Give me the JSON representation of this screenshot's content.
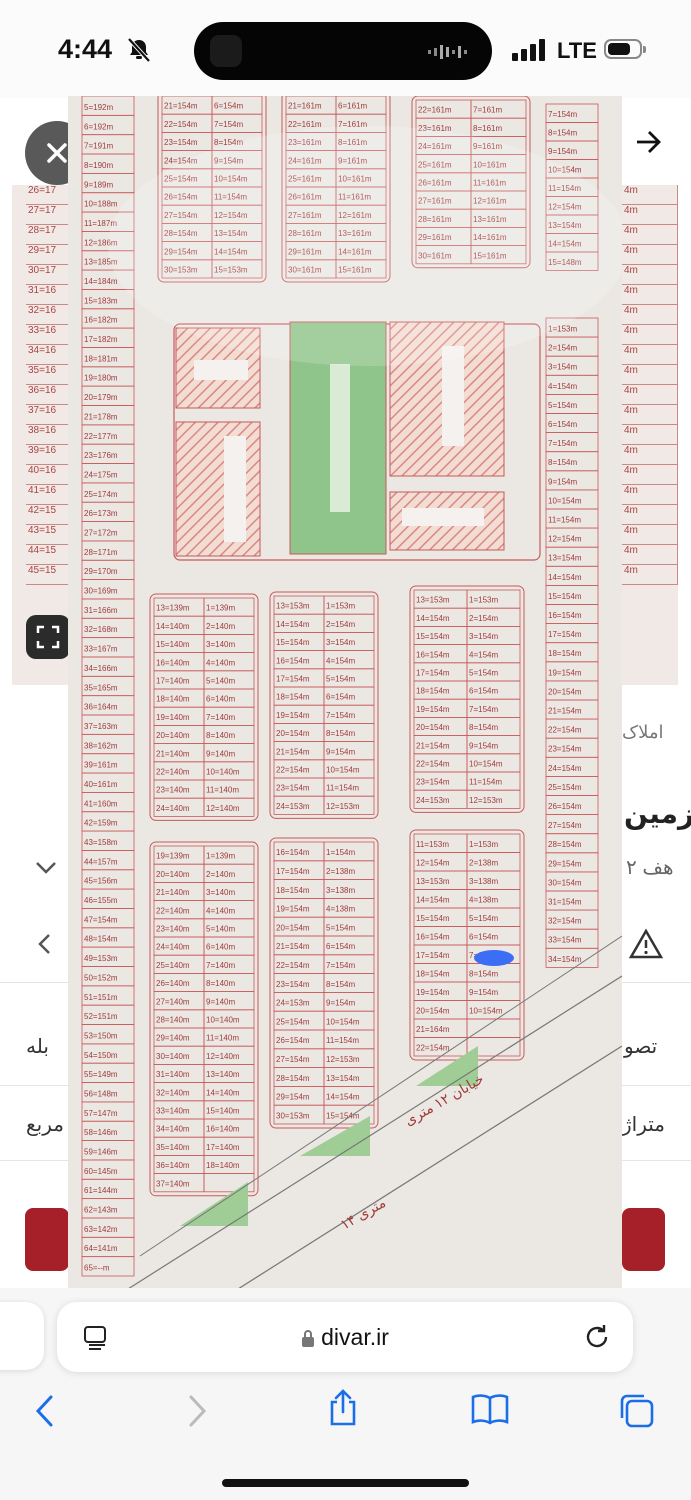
{
  "status_bar": {
    "time": "4:44",
    "network": "LTE"
  },
  "background_page": {
    "category": "املاک",
    "title_fragment": "زمین",
    "subtitle_fragment": "۲ هف",
    "row1_label": "تصو",
    "row1_value": "بله",
    "row2_label": "متراژ",
    "row2_value": "مربع"
  },
  "browser": {
    "url": "divar.ir"
  },
  "map": {
    "left_column_labels": [
      "5=192m",
      "6=192m",
      "7=191m",
      "8=190m",
      "9=189m",
      "10=188m",
      "11=187m",
      "12=186m",
      "13=185m",
      "14=184m",
      "15=183m",
      "16=182m",
      "17=182m",
      "18=181m",
      "19=180m",
      "20=179m",
      "21=178m",
      "22=177m",
      "23=176m",
      "24=175m",
      "25=174m",
      "26=173m",
      "27=172m",
      "28=171m",
      "29=170m",
      "30=169m",
      "31=166m",
      "32=168m",
      "33=167m",
      "34=166m",
      "35=165m",
      "36=164m",
      "37=163m",
      "38=162m",
      "39=161m",
      "40=161m",
      "41=160m",
      "42=159m",
      "43=158m",
      "44=157m",
      "45=156m",
      "46=155m",
      "47=154m",
      "48=154m",
      "49=153m",
      "50=152m",
      "51=151m",
      "52=151m",
      "53=150m",
      "54=150m",
      "55=149m",
      "56=148m",
      "57=147m",
      "58=146m",
      "59=146m",
      "60=145m",
      "61=144m",
      "62=143m",
      "63=142m",
      "64=141m",
      "65=--m"
    ],
    "top_block_a": [
      "21=154m",
      "6=154m",
      "22=154m",
      "7=154m",
      "23=154m",
      "8=154m",
      "24=154m",
      "9=154m",
      "25=154m",
      "10=154m",
      "26=154m",
      "11=154m",
      "27=154m",
      "12=154m",
      "28=154m",
      "13=154m",
      "29=154m",
      "14=154m",
      "30=153m",
      "15=153m"
    ],
    "top_block_b": [
      "21=161m",
      "6=161m",
      "22=161m",
      "7=161m",
      "23=161m",
      "8=161m",
      "24=161m",
      "9=161m",
      "25=161m",
      "10=161m",
      "26=161m",
      "11=161m",
      "27=161m",
      "12=161m",
      "28=161m",
      "13=161m",
      "29=161m",
      "14=161m",
      "30=161m",
      "15=161m"
    ],
    "top_block_c": [
      "22=161m",
      "7=161m",
      "23=161m",
      "8=161m",
      "24=161m",
      "9=161m",
      "25=161m",
      "10=161m",
      "26=161m",
      "11=161m",
      "27=161m",
      "12=161m",
      "28=161m",
      "13=161m",
      "29=161m",
      "14=161m",
      "30=161m",
      "15=161m"
    ],
    "top_right_column": [
      "7=154m",
      "8=154m",
      "9=154m",
      "10=154m",
      "11=154m",
      "12=154m",
      "13=154m",
      "14=154m",
      "15=148m"
    ],
    "right_column": [
      "1=153m",
      "2=154m",
      "3=154m",
      "4=154m",
      "5=154m",
      "6=154m",
      "7=154m",
      "8=154m",
      "9=154m",
      "10=154m",
      "11=154m",
      "12=154m",
      "13=154m",
      "14=154m",
      "15=154m",
      "16=154m",
      "17=154m",
      "18=154m",
      "19=154m",
      "20=154m",
      "21=154m",
      "22=154m",
      "23=154m",
      "24=154m",
      "25=154m",
      "26=154m",
      "27=154m",
      "28=154m",
      "29=154m",
      "30=154m",
      "31=154m",
      "32=154m",
      "33=154m",
      "34=154m"
    ],
    "block1": [
      "13=139m",
      "1=139m",
      "14=140m",
      "2=140m",
      "15=140m",
      "3=140m",
      "16=140m",
      "4=140m",
      "17=140m",
      "5=140m",
      "18=140m",
      "6=140m",
      "19=140m",
      "7=140m",
      "20=140m",
      "8=140m",
      "21=140m",
      "9=140m",
      "22=140m",
      "10=140m",
      "23=140m",
      "11=140m",
      "24=140m",
      "12=140m"
    ],
    "block2": [
      "13=153m",
      "1=153m",
      "14=154m",
      "2=154m",
      "15=154m",
      "3=154m",
      "16=154m",
      "4=154m",
      "17=154m",
      "5=154m",
      "18=154m",
      "6=154m",
      "19=154m",
      "7=154m",
      "20=154m",
      "8=154m",
      "21=154m",
      "9=154m",
      "22=154m",
      "10=154m",
      "23=154m",
      "11=154m",
      "24=153m",
      "12=153m"
    ],
    "block3": [
      "13=153m",
      "1=153m",
      "14=154m",
      "2=154m",
      "15=154m",
      "3=154m",
      "16=154m",
      "4=154m",
      "17=154m",
      "5=154m",
      "18=154m",
      "6=154m",
      "19=154m",
      "7=154m",
      "20=154m",
      "8=154m",
      "21=154m",
      "9=154m",
      "22=154m",
      "10=154m",
      "23=154m",
      "11=154m",
      "24=153m",
      "12=153m"
    ],
    "block4": [
      "19=139m",
      "1=139m",
      "20=140m",
      "2=140m",
      "21=140m",
      "3=140m",
      "22=140m",
      "4=140m",
      "23=140m",
      "5=140m",
      "24=140m",
      "6=140m",
      "25=140m",
      "7=140m",
      "26=140m",
      "8=140m",
      "27=140m",
      "9=140m",
      "28=140m",
      "10=140m",
      "29=140m",
      "11=140m",
      "30=140m",
      "12=140m",
      "31=140m",
      "13=140m",
      "32=140m",
      "14=140m",
      "33=140m",
      "15=140m",
      "34=140m",
      "16=140m",
      "35=140m",
      "17=140m",
      "36=140m",
      "18=140m",
      "37=140m",
      ""
    ],
    "block5": [
      "16=154m",
      "1=154m",
      "17=154m",
      "2=138m",
      "18=154m",
      "3=138m",
      "19=154m",
      "4=138m",
      "20=154m",
      "5=154m",
      "21=154m",
      "6=154m",
      "22=154m",
      "7=154m",
      "23=154m",
      "8=154m",
      "24=153m",
      "9=154m",
      "25=154m",
      "10=154m",
      "26=154m",
      "11=154m",
      "27=154m",
      "12=153m",
      "28=154m",
      "13=154m",
      "29=154m",
      "14=154m",
      "30=153m",
      "15=154m"
    ],
    "block6": [
      "11=153m",
      "1=153m",
      "12=154m",
      "2=138m",
      "13=153m",
      "3=138m",
      "14=154m",
      "4=138m",
      "15=154m",
      "5=154m",
      "16=154m",
      "6=154m",
      "17=154m",
      "7=154m",
      "18=154m",
      "8=154m",
      "19=154m",
      "9=154m",
      "20=154m",
      "10=154m",
      "21=164m",
      "",
      "22=154m",
      ""
    ],
    "street_label_1": "خیابان ۱۲ متری",
    "street_label_2": "۱۴ متری"
  }
}
